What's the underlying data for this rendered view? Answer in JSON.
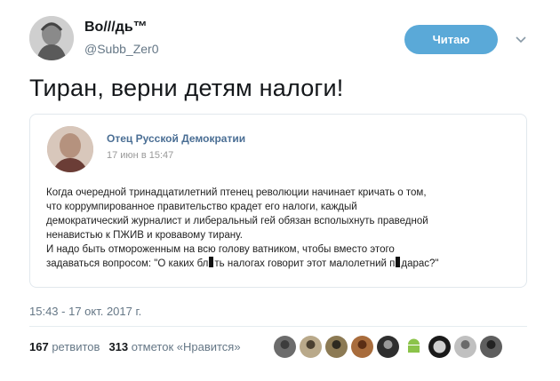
{
  "author": {
    "display_name": "Во///дь™",
    "handle": "@Subb_Zer0"
  },
  "follow_button": {
    "label": "Читаю"
  },
  "tweet": {
    "text": "Тиран, верни детям налоги!",
    "timestamp": "15:43 - 17 окт. 2017 г."
  },
  "quote": {
    "author_name": "Отец Русской Демократии",
    "date": "17 июн в 15:47",
    "line1": "Когда очередной тринадцатилетний птенец революции начинает кричать о том,",
    "line2": "что коррумпированное правительство крадет его налоги, каждый",
    "line3": "демократический журналист и либеральный гей обязан всполыхнуть праведной",
    "line4": "ненавистью к ПЖИВ и кровавому тирану.",
    "line5": "И надо быть отмороженным на всю голову ватником, чтобы вместо этого",
    "line6_a": "задаваться вопросом: \"О каких бл",
    "line6_b": "ть налогах говорит этот малолетний п",
    "line6_c": "дарас?\""
  },
  "stats": {
    "retweets_count": "167",
    "retweets_label": "ретвитов",
    "likes_count": "313",
    "likes_label": "отметок «Нравится»"
  },
  "colors": {
    "follow_button": "#5aa9d8",
    "quote_author": "#4a6e94",
    "muted_text": "#657786"
  },
  "icons": {
    "caret": "chevron-down-icon"
  }
}
